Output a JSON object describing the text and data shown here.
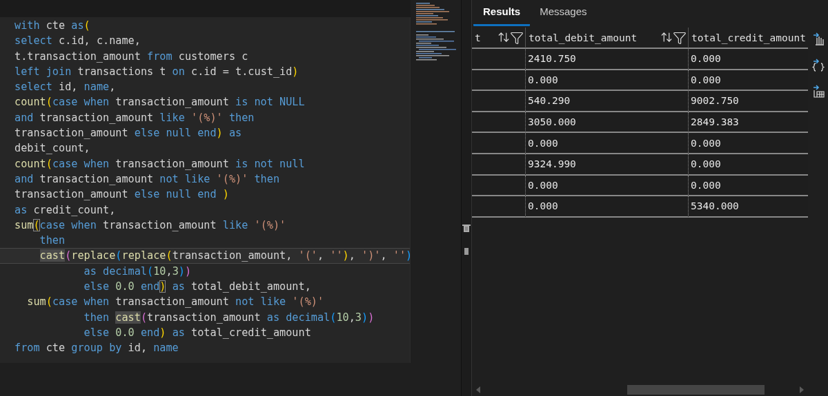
{
  "editor": {
    "lines": [
      {
        "current": false,
        "tokens": [
          {
            "kw": "with"
          },
          {
            "pl": " cte "
          },
          {
            "kw": "as"
          },
          {
            "p1": "("
          }
        ]
      },
      {
        "current": false,
        "tokens": [
          {
            "kw": "select"
          },
          {
            "pl": " c.id, c.name,"
          }
        ]
      },
      {
        "current": false,
        "tokens": [
          {
            "pl": "t.transaction_amount "
          },
          {
            "kw": "from"
          },
          {
            "pl": " customers c"
          }
        ]
      },
      {
        "current": false,
        "tokens": [
          {
            "kw": "left join"
          },
          {
            "pl": " transactions t "
          },
          {
            "kw": "on"
          },
          {
            "pl": " c.id = t.cust_id"
          },
          {
            "p1": ")"
          }
        ]
      },
      {
        "current": false,
        "tokens": [
          {
            "kw": "select"
          },
          {
            "pl": " id, "
          },
          {
            "kw": "name"
          },
          {
            "pl": ","
          }
        ]
      },
      {
        "current": false,
        "tokens": [
          {
            "fn": "count"
          },
          {
            "p1": "("
          },
          {
            "kw": "case when"
          },
          {
            "pl": " transaction_amount "
          },
          {
            "kw": "is not NULL"
          }
        ]
      },
      {
        "current": false,
        "tokens": [
          {
            "kw": "and"
          },
          {
            "pl": " transaction_amount "
          },
          {
            "kw": "like "
          },
          {
            "str": "'(%)'"
          },
          {
            "kw": " then"
          }
        ]
      },
      {
        "current": false,
        "tokens": [
          {
            "pl": "transaction_amount "
          },
          {
            "kw": "else null end"
          },
          {
            "p1": ")"
          },
          {
            "kw": " as"
          }
        ]
      },
      {
        "current": false,
        "tokens": [
          {
            "pl": "debit_count,"
          }
        ]
      },
      {
        "current": false,
        "tokens": [
          {
            "fn": "count"
          },
          {
            "p1": "("
          },
          {
            "kw": "case when"
          },
          {
            "pl": " transaction_amount "
          },
          {
            "kw": "is not null"
          }
        ]
      },
      {
        "current": false,
        "tokens": [
          {
            "kw": "and"
          },
          {
            "pl": " transaction_amount "
          },
          {
            "kw": "not like "
          },
          {
            "str": "'(%)'"
          },
          {
            "kw": " then"
          }
        ]
      },
      {
        "current": false,
        "tokens": [
          {
            "pl": "transaction_amount "
          },
          {
            "kw": "else null end"
          },
          {
            "p1": " )"
          }
        ]
      },
      {
        "current": false,
        "tokens": [
          {
            "kw": "as"
          },
          {
            "pl": " credit_count,"
          }
        ]
      },
      {
        "current": false,
        "tokens": [
          {
            "fn": "sum"
          },
          {
            "p1box": "("
          },
          {
            "kw": "case when"
          },
          {
            "pl": " transaction_amount "
          },
          {
            "kw": "like "
          },
          {
            "str": "'(%)'"
          }
        ]
      },
      {
        "current": false,
        "tokens": [
          {
            "kw": "    then"
          }
        ]
      },
      {
        "current": true,
        "tokens": [
          {
            "fnhl": "    cast"
          },
          {
            "p2": "("
          },
          {
            "fn": "replace"
          },
          {
            "p3": "("
          },
          {
            "fn": "replace"
          },
          {
            "p1": "("
          },
          {
            "pl": "transaction_amount, "
          },
          {
            "str": "'('"
          },
          {
            "pl": ", "
          },
          {
            "str": "''"
          },
          {
            "p1": ")"
          },
          {
            "pl": ", "
          },
          {
            "str": "')'"
          },
          {
            "pl": ", "
          },
          {
            "str": "''"
          },
          {
            "p3": ")"
          }
        ]
      },
      {
        "current": false,
        "tokens": [
          {
            "kw": "           as decimal"
          },
          {
            "p3": "("
          },
          {
            "num": "10"
          },
          {
            "pl": ","
          },
          {
            "num": "3"
          },
          {
            "p3": ")"
          },
          {
            "p2": ")"
          }
        ]
      },
      {
        "current": false,
        "tokens": [
          {
            "kw": "           else "
          },
          {
            "num": "0.0"
          },
          {
            "kw": " end"
          },
          {
            "p1box": ")"
          },
          {
            "kw": " as"
          },
          {
            "pl": " total_debit_amount,"
          }
        ]
      },
      {
        "current": false,
        "tokens": [
          {
            "fn": "  sum"
          },
          {
            "p1": "("
          },
          {
            "kw": "case when"
          },
          {
            "pl": " transaction_amount "
          },
          {
            "kw": "not like "
          },
          {
            "str": "'(%)'"
          }
        ]
      },
      {
        "current": false,
        "tokens": [
          {
            "kw": "           then "
          },
          {
            "fnhl": "cast"
          },
          {
            "p2": "("
          },
          {
            "pl": "transaction_amount "
          },
          {
            "kw": "as decimal"
          },
          {
            "p3": "("
          },
          {
            "num": "10"
          },
          {
            "pl": ","
          },
          {
            "num": "3"
          },
          {
            "p3": ")"
          },
          {
            "p2": ")"
          }
        ]
      },
      {
        "current": false,
        "tokens": [
          {
            "kw": "           else "
          },
          {
            "num": "0.0"
          },
          {
            "kw": " end"
          },
          {
            "p1": ")"
          },
          {
            "kw": " as"
          },
          {
            "pl": " total_credit_amount"
          }
        ]
      },
      {
        "current": false,
        "tokens": [
          {
            "kw": "from"
          },
          {
            "pl": " cte "
          },
          {
            "kw": "group by"
          },
          {
            "pl": " id, "
          },
          {
            "kw": "name"
          }
        ]
      }
    ]
  },
  "results": {
    "tabs": [
      {
        "label": "Results",
        "selected": true
      },
      {
        "label": "Messages",
        "selected": false
      }
    ],
    "table": {
      "columns": [
        {
          "label": "t",
          "sort_filter_icons": true
        },
        {
          "label": "total_debit_amount",
          "sort_filter_icons": true
        },
        {
          "label": "total_credit_amount",
          "sort_filter_icons": false
        }
      ],
      "rows": [
        [
          "",
          "2410.750",
          "0.000"
        ],
        [
          "",
          "0.000",
          "0.000"
        ],
        [
          "",
          "540.290",
          "9002.750"
        ],
        [
          "",
          "3050.000",
          "2849.383"
        ],
        [
          "",
          "0.000",
          "0.000"
        ],
        [
          "",
          "9324.990",
          "0.000"
        ],
        [
          "",
          "0.000",
          "0.000"
        ],
        [
          "",
          "0.000",
          "5340.000"
        ]
      ]
    }
  }
}
